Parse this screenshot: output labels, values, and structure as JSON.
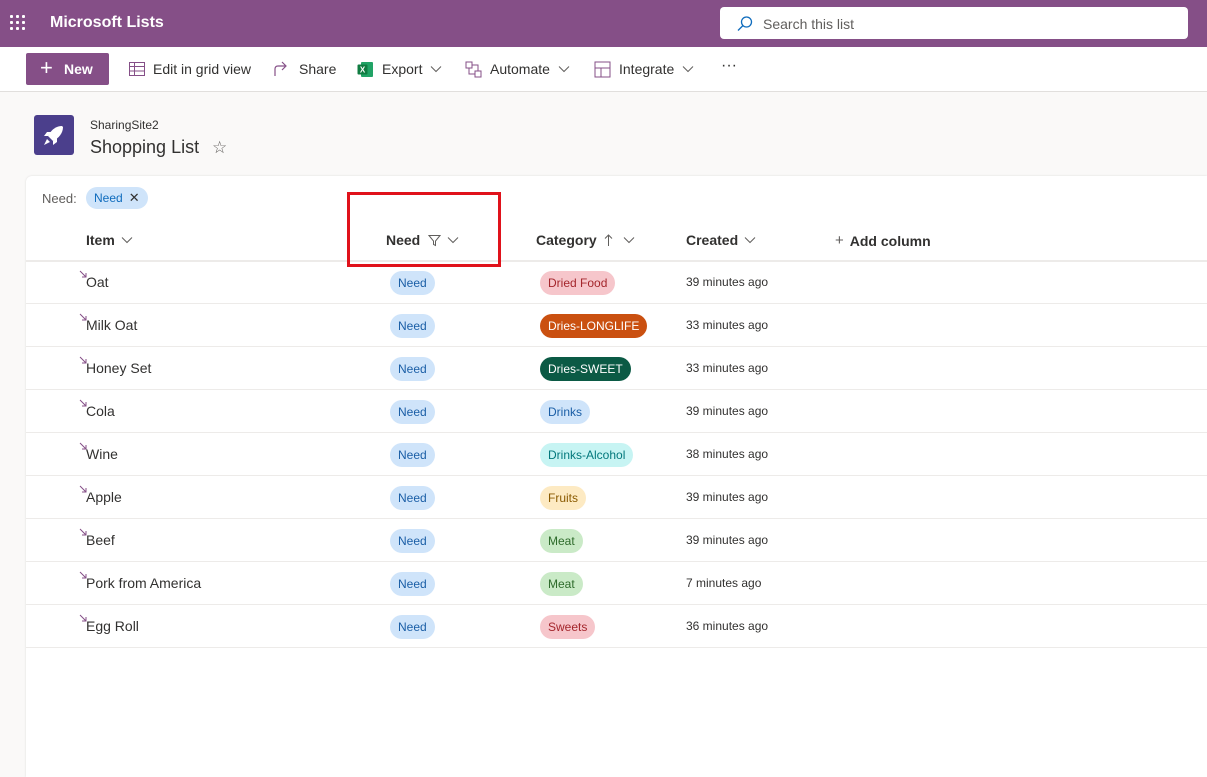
{
  "app": {
    "title": "Microsoft Lists"
  },
  "search": {
    "placeholder": "Search this list"
  },
  "toolbar": {
    "new_label": "New",
    "edit_grid_label": "Edit in grid view",
    "share_label": "Share",
    "export_label": "Export",
    "automate_label": "Automate",
    "integrate_label": "Integrate",
    "more_label": "···"
  },
  "site": {
    "name": "SharingSite2",
    "list_title": "Shopping List"
  },
  "filter": {
    "label": "Need:",
    "value": "Need"
  },
  "columns": {
    "item": "Item",
    "need": "Need",
    "category": "Category",
    "created": "Created",
    "add": "Add column"
  },
  "rows": [
    {
      "item": "Oat",
      "need": "Need",
      "category": "Dried Food",
      "created": "39 minutes ago"
    },
    {
      "item": "Milk Oat",
      "need": "Need",
      "category": "Dries-LONGLIFE",
      "created": "33 minutes ago"
    },
    {
      "item": "Honey Set",
      "need": "Need",
      "category": "Dries-SWEET",
      "created": "33 minutes ago"
    },
    {
      "item": "Cola",
      "need": "Need",
      "category": "Drinks",
      "created": "39 minutes ago"
    },
    {
      "item": "Wine",
      "need": "Need",
      "category": "Drinks-Alcohol",
      "created": "38 minutes ago"
    },
    {
      "item": "Apple",
      "need": "Need",
      "category": "Fruits",
      "created": "39 minutes ago"
    },
    {
      "item": "Beef",
      "need": "Need",
      "category": "Meat",
      "created": "39 minutes ago"
    },
    {
      "item": "Pork from America",
      "need": "Need",
      "category": "Meat",
      "created": "7 minutes ago"
    },
    {
      "item": "Egg Roll",
      "need": "Need",
      "category": "Sweets",
      "created": "36 minutes ago"
    }
  ],
  "category_colors": {
    "Dried Food": {
      "bg": "#f6c6cb",
      "fg": "#a4262c"
    },
    "Dries-LONGLIFE": {
      "bg": "#ca5010",
      "fg": "#ffffff"
    },
    "Dries-SWEET": {
      "bg": "#0b5a45",
      "fg": "#ffffff"
    },
    "Drinks": {
      "bg": "#cfe4fa",
      "fg": "#1a5ea6"
    },
    "Drinks-Alcohol": {
      "bg": "#c7f4f3",
      "fg": "#03787c"
    },
    "Fruits": {
      "bg": "#fdeac3",
      "fg": "#8a5a00"
    },
    "Meat": {
      "bg": "#caeac7",
      "fg": "#2e6b2b"
    },
    "Sweets": {
      "bg": "#f6c6cb",
      "fg": "#a4262c"
    }
  },
  "colors": {
    "suite_bar": "#854f87",
    "highlight": "#e0121b"
  }
}
